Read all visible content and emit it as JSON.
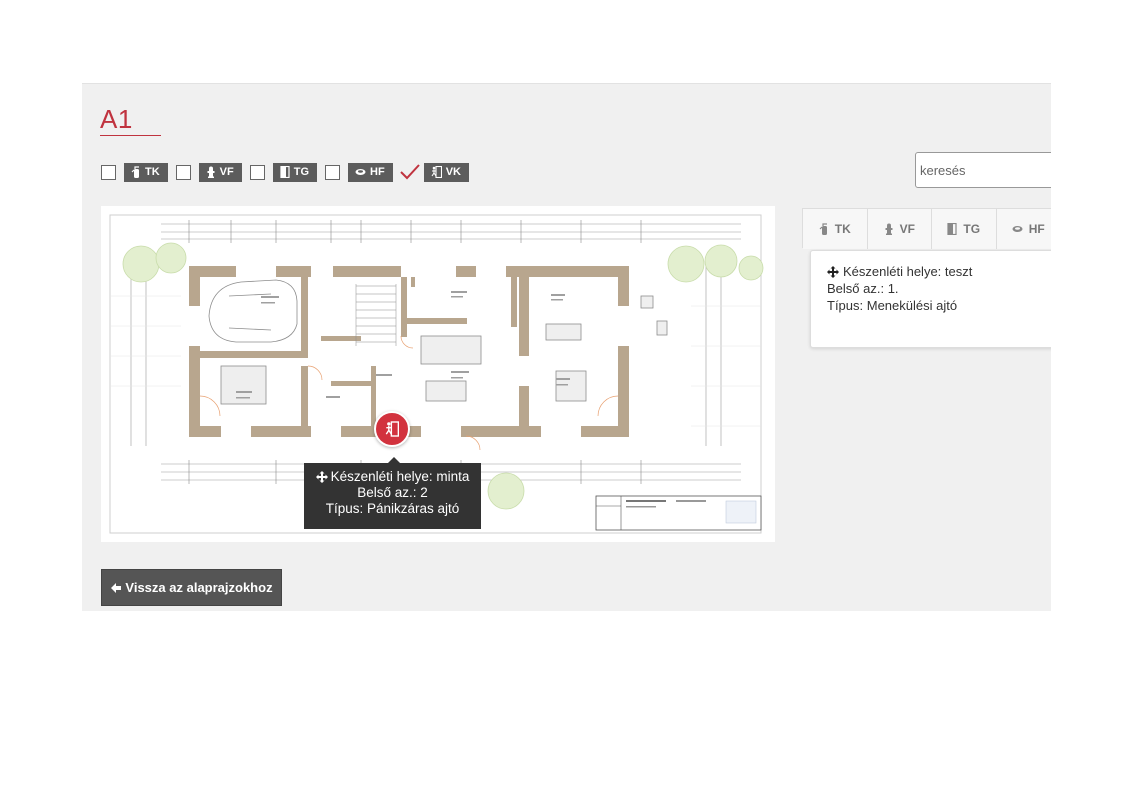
{
  "header": {
    "title": "A1"
  },
  "filters": [
    {
      "label": "TK",
      "icon": "fire-extinguisher-icon",
      "checked": false
    },
    {
      "label": "VF",
      "icon": "hydrant-icon",
      "checked": false
    },
    {
      "label": "TG",
      "icon": "door-icon",
      "checked": false
    },
    {
      "label": "HF",
      "icon": "smoke-detector-icon",
      "checked": false
    },
    {
      "label": "VK",
      "icon": "emergency-exit-icon",
      "checked": true
    }
  ],
  "search": {
    "placeholder": "keresés"
  },
  "tooltip": {
    "line1": "Készenléti helye: minta",
    "line2": "Belső az.: 2",
    "line3": "Típus: Pánikzáras ajtó"
  },
  "tabs": [
    {
      "label": "TK"
    },
    {
      "label": "VF"
    },
    {
      "label": "TG"
    },
    {
      "label": "HF"
    }
  ],
  "info": {
    "line1": "Készenléti helye: teszt",
    "line2": "Belső az.: 1.",
    "line3": "Típus: Menekülési ajtó"
  },
  "back_button": {
    "label": "Vissza az alaprajzokhoz"
  },
  "colors": {
    "accent": "#c0333f",
    "marker": "#d2323e",
    "badge": "#5c5c5c",
    "panel": "#f0f0f0"
  }
}
